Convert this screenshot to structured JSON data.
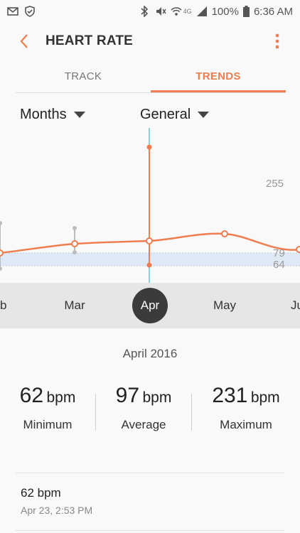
{
  "status_bar": {
    "battery": "100%",
    "time": "6:36 AM",
    "network": "4G"
  },
  "header": {
    "title": "HEART RATE"
  },
  "tabs": [
    {
      "label": "TRACK",
      "active": false
    },
    {
      "label": "TRENDS",
      "active": true
    }
  ],
  "filters": {
    "period": "Months",
    "type": "General"
  },
  "chart": {
    "axis_labels": {
      "upper": "255",
      "mid": "79",
      "lower": "64"
    }
  },
  "months": [
    {
      "label": "eb",
      "selected": false
    },
    {
      "label": "Mar",
      "selected": false
    },
    {
      "label": "Apr",
      "selected": true
    },
    {
      "label": "May",
      "selected": false
    },
    {
      "label": "Ju",
      "selected": false
    }
  ],
  "summary": {
    "period": "April 2016",
    "minimum": {
      "value": "62",
      "unit": "bpm",
      "label": "Minimum"
    },
    "average": {
      "value": "97",
      "unit": "bpm",
      "label": "Average"
    },
    "maximum": {
      "value": "231",
      "unit": "bpm",
      "label": "Maximum"
    }
  },
  "records": [
    {
      "value": "62 bpm",
      "time": "Apr 23, 2:53 PM"
    }
  ],
  "colors": {
    "accent": "#ef7d4f",
    "cursor": "#5fc6d8",
    "band": "#dfe9f5"
  }
}
